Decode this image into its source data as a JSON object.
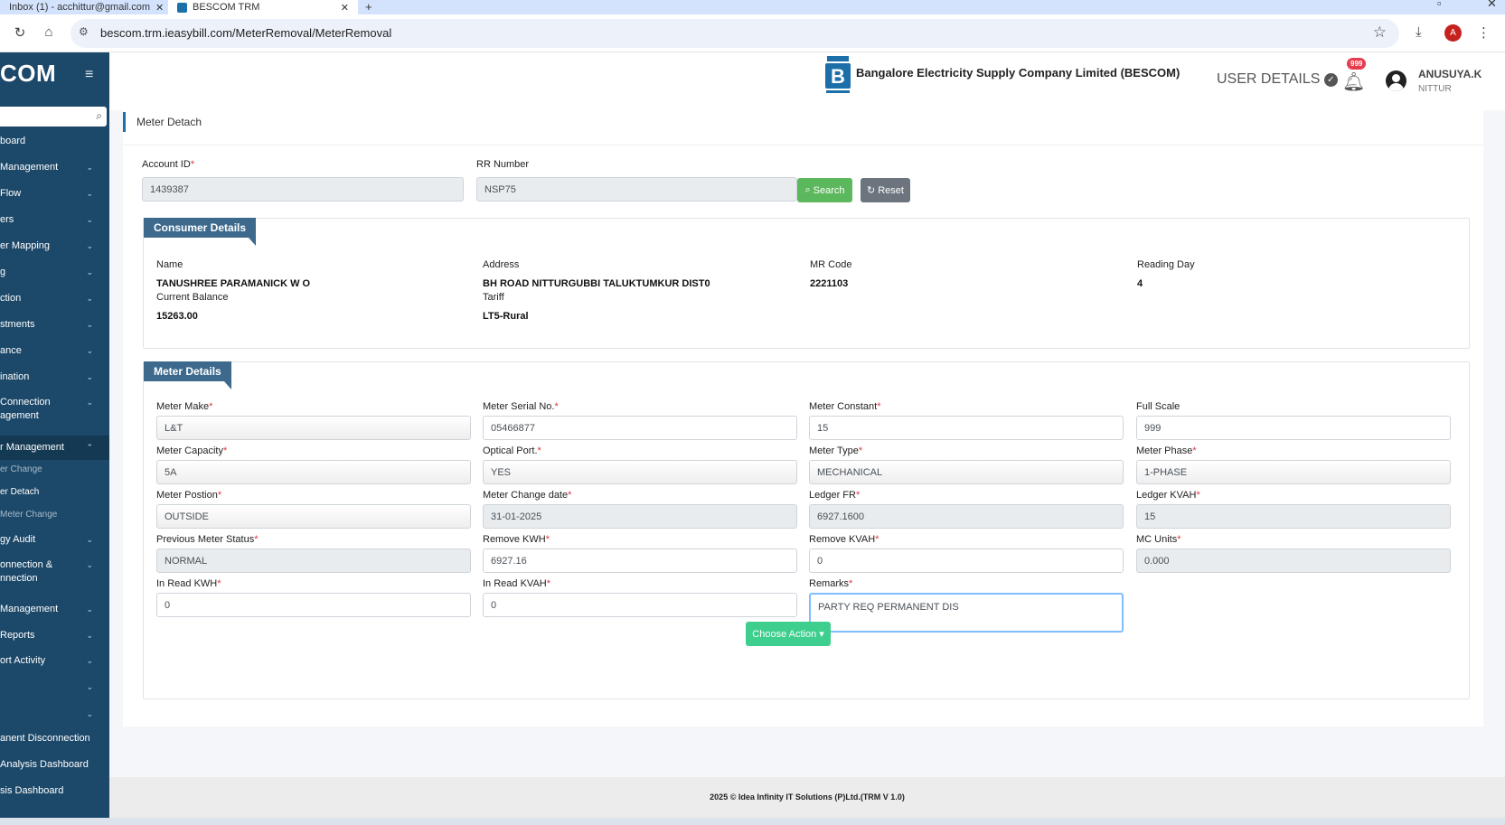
{
  "browser": {
    "tabs": [
      {
        "title": "Inbox (1) - acchittur@gmail.com"
      },
      {
        "title": "BESCOM TRM"
      }
    ],
    "url": "bescom.trm.ieasybill.com/MeterRemoval/MeterRemoval",
    "profile_initial": "A"
  },
  "sidebar": {
    "brand": "COM",
    "items": [
      {
        "label": "board"
      },
      {
        "label": "Management"
      },
      {
        "label": "Flow"
      },
      {
        "label": "ers"
      },
      {
        "label": "er Mapping"
      },
      {
        "label": "g"
      },
      {
        "label": "ction"
      },
      {
        "label": "stments"
      },
      {
        "label": "ance"
      },
      {
        "label": "ination"
      },
      {
        "label": "Connection agement"
      },
      {
        "label": "r Management"
      },
      {
        "label": "gy Audit"
      },
      {
        "label": "onnection & nnection"
      },
      {
        "label": "Management"
      },
      {
        "label": "Reports"
      },
      {
        "label": "ort Activity"
      },
      {
        "label": ""
      },
      {
        "label": ""
      },
      {
        "label": "anent Disconnection"
      },
      {
        "label": "Analysis Dashboard"
      },
      {
        "label": "sis Dashboard"
      }
    ],
    "subitems": [
      {
        "label": "er Change"
      },
      {
        "label": "er Detach"
      },
      {
        "label": "Meter Change"
      }
    ]
  },
  "header": {
    "company": "Bangalore Electricity Supply Company Limited (BESCOM)",
    "user_details": "USER DETAILS",
    "notifications": "999",
    "user_name": "ANUSUYA.K",
    "user_location": "NITTUR"
  },
  "page": {
    "title": "Meter Detach",
    "search": {
      "account_id_label": "Account ID",
      "account_id_value": "1439387",
      "rr_label": "RR Number",
      "rr_value": "NSP75",
      "search_btn": "Search",
      "reset_btn": "Reset"
    },
    "consumer": {
      "title": "Consumer Details",
      "name_label": "Name",
      "name": "TANUSHREE PARAMANICK W O",
      "address_label": "Address",
      "address": "BH ROAD NITTURGUBBI TALUKTUMKUR DIST0",
      "mr_code_label": "MR Code",
      "mr_code": "2221103",
      "reading_day_label": "Reading Day",
      "reading_day": "4",
      "balance_label": "Current Balance",
      "balance": "15263.00",
      "tariff_label": "Tariff",
      "tariff": "LT5-Rural"
    },
    "meter": {
      "title": "Meter Details",
      "fields": [
        {
          "label": "Meter Make",
          "value": "L&T"
        },
        {
          "label": "Meter Serial No.",
          "value": "05466877"
        },
        {
          "label": "Meter Constant",
          "value": "15"
        },
        {
          "label": "Full Scale",
          "value": "999"
        },
        {
          "label": "Meter Capacity",
          "value": "5A"
        },
        {
          "label": "Optical Port.",
          "value": "YES"
        },
        {
          "label": "Meter Type",
          "value": "MECHANICAL"
        },
        {
          "label": "Meter Phase",
          "value": "1-PHASE"
        },
        {
          "label": "Meter Postion",
          "value": "OUTSIDE"
        },
        {
          "label": "Meter Change date",
          "value": "31-01-2025"
        },
        {
          "label": "Ledger FR",
          "value": "6927.1600"
        },
        {
          "label": "Ledger KVAH",
          "value": "15"
        },
        {
          "label": "Previous Meter Status",
          "value": "NORMAL"
        },
        {
          "label": "Remove KWH",
          "value": "6927.16"
        },
        {
          "label": "Remove KVAH",
          "value": "0"
        },
        {
          "label": "MC Units",
          "value": "0.000"
        },
        {
          "label": "In Read KWH",
          "value": "0"
        },
        {
          "label": "In Read KVAH",
          "value": "0"
        },
        {
          "label": "Remarks",
          "value": "PARTY REQ PERMANENT DIS"
        }
      ],
      "choose_action": "Choose Action"
    }
  },
  "footer": "2025 © Idea Infinity IT Solutions (P)Ltd.(TRM V 1.0)"
}
